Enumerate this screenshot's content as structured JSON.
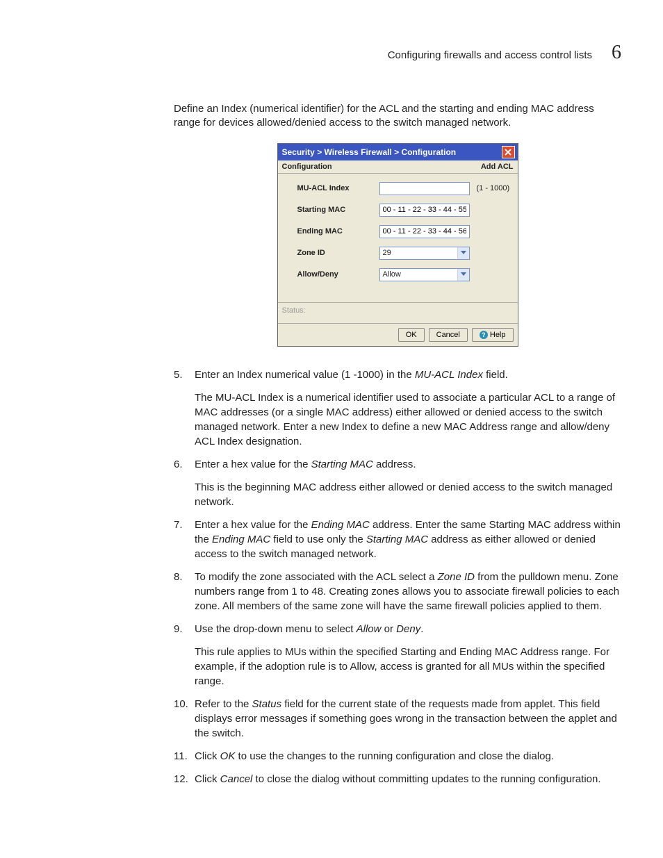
{
  "header": {
    "title": "Configuring firewalls and access control lists",
    "chapter": "6"
  },
  "intro": "Define an Index (numerical identifier) for the ACL and the starting and ending MAC address range for devices allowed/denied access to the switch managed network.",
  "dialog": {
    "titlebar": "Security > Wireless Firewall > Configuration",
    "conf_left": "Configuration",
    "conf_right": "Add ACL",
    "fields": {
      "mu_acl_index": {
        "label": "MU-ACL Index",
        "value": "",
        "hint": "(1 - 1000)"
      },
      "starting_mac": {
        "label": "Starting MAC",
        "value": "00 - 11 - 22 - 33 - 44 - 55"
      },
      "ending_mac": {
        "label": "Ending MAC",
        "value": "00 - 11 - 22 - 33 - 44 - 56"
      },
      "zone_id": {
        "label": "Zone ID",
        "value": "29"
      },
      "allow_deny": {
        "label": "Allow/Deny",
        "value": "Allow"
      }
    },
    "status_label": "Status:",
    "buttons": {
      "ok": "OK",
      "cancel": "Cancel",
      "help": "Help"
    }
  },
  "steps": [
    {
      "num": "5.",
      "lead_before": "Enter an Index numerical value (1 -1000) in the ",
      "lead_italic": "MU-ACL Index",
      "lead_after": " field.",
      "para": "The MU-ACL Index is a numerical identifier used to associate a particular ACL to a range of MAC addresses (or a single MAC address) either allowed or denied access to the switch managed network. Enter a new Index to define a new MAC Address range and allow/deny ACL Index designation."
    },
    {
      "num": "6.",
      "lead_before": "Enter a hex value for the ",
      "lead_italic": "Starting MAC",
      "lead_after": " address.",
      "para": "This is the beginning MAC address either allowed or denied access to the switch managed network."
    },
    {
      "num": "7.",
      "seg1_before": "Enter a hex value for the ",
      "seg1_italic": "Ending MAC",
      "seg1_after": " address. Enter the same Starting MAC address within the ",
      "seg2_italic": "Ending MAC",
      "seg2_after": " field to use only the ",
      "seg3_italic": "Starting MAC",
      "seg3_after": " address as either allowed or denied access to the switch managed network."
    },
    {
      "num": "8.",
      "lead_before": "To modify the zone associated with the ACL select a ",
      "lead_italic": "Zone ID",
      "lead_after": " from the pulldown menu. Zone numbers range from 1 to 48. Creating zones allows you to associate firewall policies to each zone. All members of the same zone will have the same firewall policies applied to them."
    },
    {
      "num": "9.",
      "seg1_before": "Use the drop-down menu to select ",
      "seg1_italic": "Allow",
      "seg1_after": " or ",
      "seg2_italic": "Deny",
      "seg2_after": ".",
      "para": "This rule applies to MUs within the specified Starting and Ending MAC Address range. For example, if the adoption rule is to Allow, access is granted for all MUs within the specified range."
    },
    {
      "num": "10.",
      "lead_before": "Refer to the ",
      "lead_italic": "Status",
      "lead_after": " field for the current state of the requests made from applet. This field displays error messages if something goes wrong in the transaction between the applet and the switch."
    },
    {
      "num": "11.",
      "lead_before": "Click ",
      "lead_italic": "OK",
      "lead_after": " to use the changes to the running configuration and close the dialog."
    },
    {
      "num": "12.",
      "lead_before": "Click ",
      "lead_italic": "Cancel",
      "lead_after": " to close the dialog without committing updates to the running configuration."
    }
  ]
}
